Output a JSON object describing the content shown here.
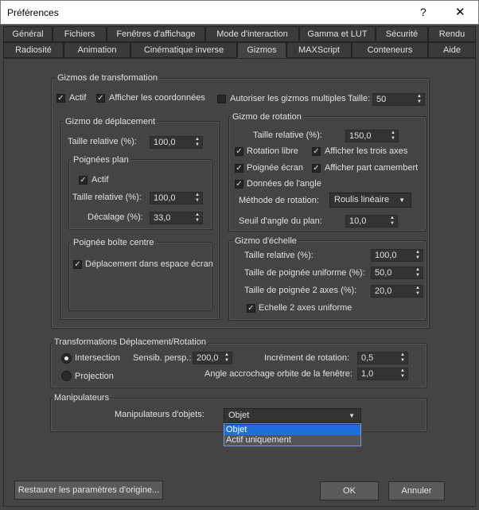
{
  "window": {
    "title": "Préférences",
    "help": "?",
    "close": "✕"
  },
  "tabs_row1": [
    "Général",
    "Fichiers",
    "Fenêtres d'affichage",
    "Mode d'interaction",
    "Gamma et LUT",
    "Sécurité",
    "Rendu"
  ],
  "tabs_row2": [
    "Radiosité",
    "Animation",
    "Cinématique inverse",
    "Gizmos",
    "MAXScript",
    "Conteneurs",
    "Aide"
  ],
  "gizmo_transform": {
    "label": "Gizmos de transformation",
    "actif": "Actif",
    "afficher_coords": "Afficher les coordonnées",
    "autoriser": "Autoriser les gizmos multiples",
    "taille_label": "Taille:",
    "taille_value": "50",
    "deplacement": {
      "label": "Gizmo de déplacement",
      "taille_rel_label": "Taille relative (%):",
      "taille_rel_value": "100,0",
      "poignees_plan": {
        "label": "Poignées plan",
        "actif": "Actif",
        "taille_rel_label": "Taille relative (%):",
        "taille_rel_value": "100,0",
        "decalage_label": "Décalage (%):",
        "decalage_value": "33,0"
      },
      "boite_centre": {
        "label": "Poignée boîte centre",
        "deplacement_ecran": "Déplacement dans espace écran"
      }
    },
    "rotation": {
      "label": "Gizmo de rotation",
      "taille_rel_label": "Taille relative (%):",
      "taille_rel_value": "150,0",
      "rotation_libre": "Rotation libre",
      "trois_axes": "Afficher les trois axes",
      "poignee_ecran": "Poignée écran",
      "camembert": "Afficher part camembert",
      "donnees_angle": "Données de l'angle",
      "methode_label": "Méthode de rotation:",
      "methode_value": "Roulis linéaire",
      "seuil_label": "Seuil d'angle du plan:",
      "seuil_value": "10,0"
    },
    "echelle": {
      "label": "Gizmo d'échelle",
      "taille_rel_label": "Taille relative (%):",
      "taille_rel_value": "100,0",
      "poignee_uniforme_label": "Taille de poignée uniforme (%):",
      "poignee_uniforme_value": "50,0",
      "poignee_2axes_label": "Taille de poignée 2 axes (%):",
      "poignee_2axes_value": "20,0",
      "echelle_2axes": "Echelle 2 axes uniforme"
    }
  },
  "transformations": {
    "label": "Transformations Déplacement/Rotation",
    "intersection": "Intersection",
    "projection": "Projection",
    "sensib_label": "Sensib. persp.:",
    "sensib_value": "200,0",
    "increment_label": "Incrément de rotation:",
    "increment_value": "0,5",
    "angle_label": "Angle accrochage orbite de la fenêtre:",
    "angle_value": "1,0"
  },
  "manipulateurs": {
    "label": "Manipulateurs",
    "objets_label": "Manipulateurs d'objets:",
    "objets_value": "Objet",
    "options": [
      "Objet",
      "Actif uniquement"
    ]
  },
  "buttons": {
    "restore": "Restaurer les paramètres d'origine...",
    "ok": "OK",
    "cancel": "Annuler"
  },
  "colors": {
    "selection": "#1e6fd9",
    "background": "#444444"
  }
}
